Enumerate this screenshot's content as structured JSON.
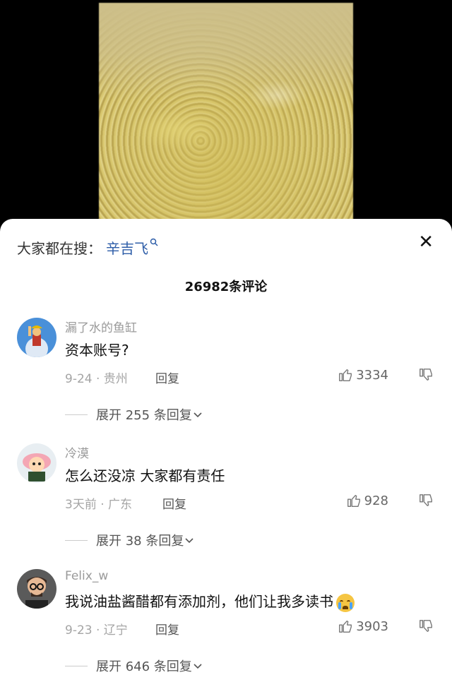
{
  "search": {
    "prefix": "大家都在搜：",
    "keyword": "辛吉飞",
    "icon": "search-icon"
  },
  "close_label": "✕",
  "comment_count": "26982条评论",
  "comments": [
    {
      "user": "漏了水的鱼缸",
      "text": "资本账号?",
      "meta": "9-24 · 贵州",
      "reply": "回复",
      "likes": "3334",
      "expand": "展开 255 条回复"
    },
    {
      "user": "冷漠",
      "text": "怎么还没凉 大家都有责任",
      "meta": "3天前 · 广东",
      "reply": "回复",
      "likes": "928",
      "expand": "展开 38 条回复"
    },
    {
      "user": "Felix_w",
      "text": "我说油盐酱醋都有添加剂，他们让我多读书",
      "meta": "9-23 · 辽宁",
      "reply": "回复",
      "likes": "3903",
      "expand": "展开 646 条回复"
    }
  ]
}
